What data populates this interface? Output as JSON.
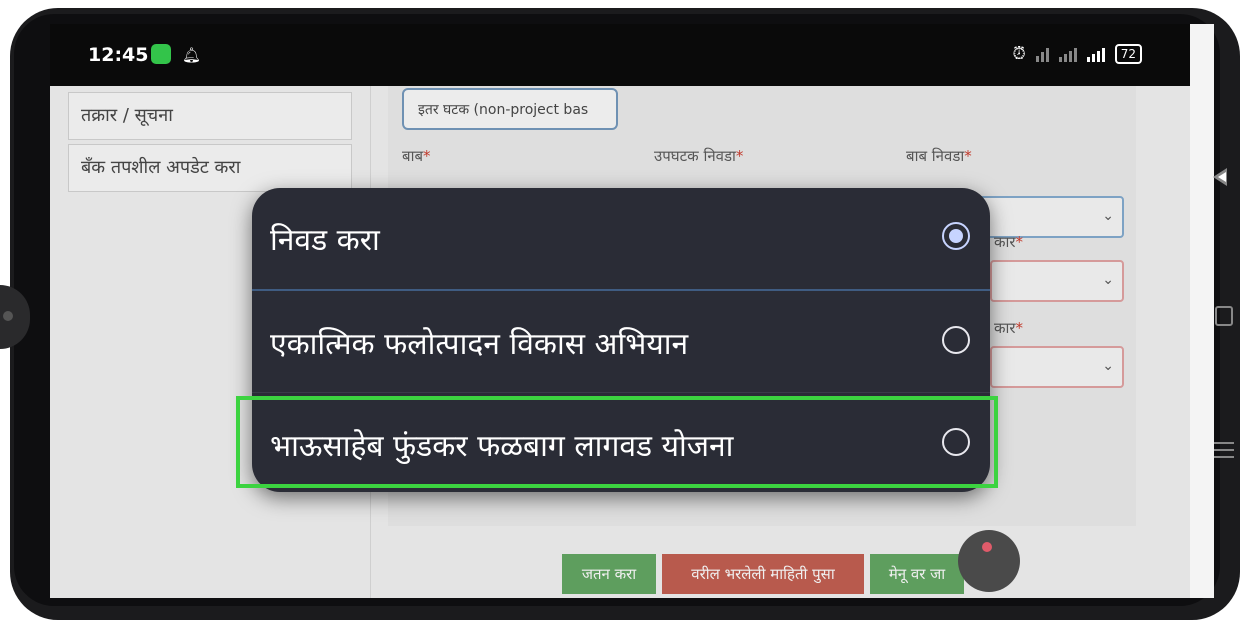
{
  "status_bar": {
    "time": "12:45",
    "battery": "72",
    "icons": [
      "app-notification-icon",
      "bell-icon",
      "alarm-icon",
      "volte-icon",
      "signal-icon",
      "wifi-signal-icon",
      "battery-icon"
    ]
  },
  "sidebar": {
    "items": [
      {
        "label": "तक्रार / सूचना"
      },
      {
        "label": "बँक तपशील अपडेट करा"
      }
    ]
  },
  "form": {
    "top_select_value": "इतर घटक (non-project bas",
    "labels": {
      "bab": "बाब",
      "upghatak": "उपघटक निवडा",
      "bab_nivda": "बाब निवडा",
      "prakar1": "कार",
      "prakar2": "कार"
    },
    "required_mark": "*"
  },
  "buttons": {
    "save": "जतन करा",
    "clear": "वरील भरलेली माहिती पुसा",
    "menu": "मेनू वर जा"
  },
  "dialog": {
    "options": [
      {
        "label": "निवड करा",
        "selected": true
      },
      {
        "label": "एकात्मिक फलोत्पादन विकास अभियान",
        "selected": false
      },
      {
        "label": "भाऊसाहेब फुंडकर फळबाग लागवड योजना",
        "selected": false
      }
    ],
    "highlight_color": "#3cd340"
  },
  "colors": {
    "dialog_bg": "#2a2c36",
    "green_button": "#5e9e5e",
    "red_button": "#b85a4d",
    "highlight": "#3cd340"
  }
}
